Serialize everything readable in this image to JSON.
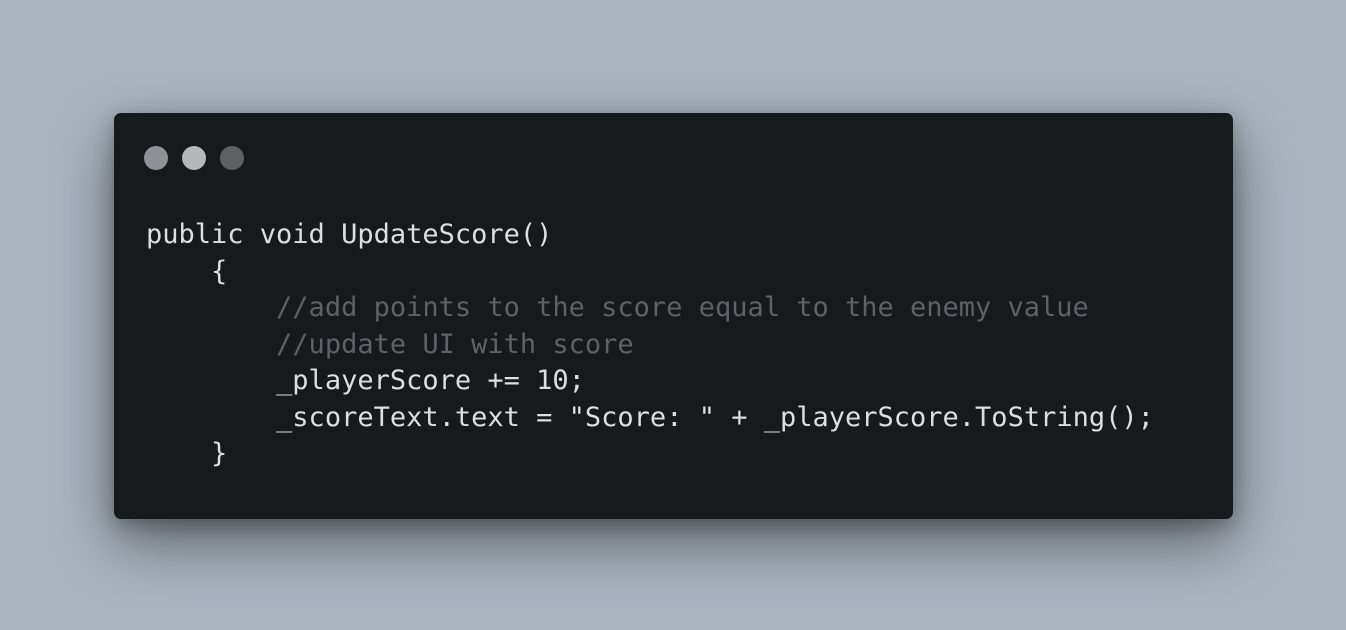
{
  "window": {
    "dots": [
      {
        "name": "window-dot-1",
        "color": "#8e9296"
      },
      {
        "name": "window-dot-2",
        "color": "#b5b8bb"
      },
      {
        "name": "window-dot-3",
        "color": "#5e6164"
      }
    ]
  },
  "code": {
    "lines": [
      {
        "indent": 0,
        "tokens": [
          {
            "type": "plain",
            "text": "public void UpdateScore()"
          }
        ]
      },
      {
        "indent": 1,
        "tokens": [
          {
            "type": "plain",
            "text": "{"
          }
        ]
      },
      {
        "indent": 2,
        "tokens": [
          {
            "type": "comment",
            "text": "//add points to the score equal to the enemy value"
          }
        ]
      },
      {
        "indent": 2,
        "tokens": [
          {
            "type": "comment",
            "text": "//update UI with score"
          }
        ]
      },
      {
        "indent": 2,
        "tokens": [
          {
            "type": "plain",
            "text": "_playerScore += "
          },
          {
            "type": "number",
            "text": "10"
          },
          {
            "type": "plain",
            "text": ";"
          }
        ]
      },
      {
        "indent": 2,
        "tokens": [
          {
            "type": "plain",
            "text": "_scoreText.text = "
          },
          {
            "type": "string",
            "text": "\"Score: \""
          },
          {
            "type": "plain",
            "text": " + _playerScore.ToString();"
          }
        ]
      },
      {
        "indent": 1,
        "tokens": [
          {
            "type": "plain",
            "text": "}"
          }
        ]
      }
    ]
  }
}
